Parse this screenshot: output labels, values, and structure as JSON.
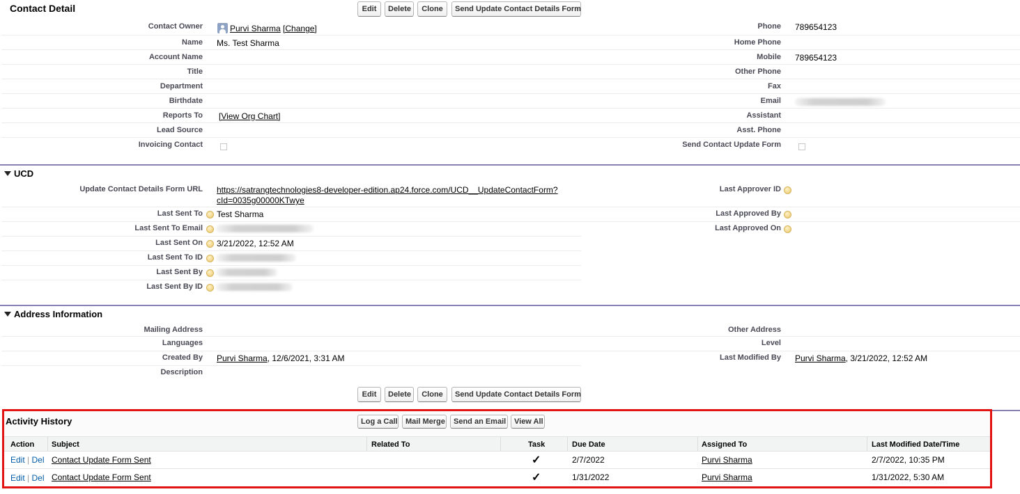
{
  "detail": {
    "title": "Contact Detail",
    "buttons": [
      "Edit",
      "Delete",
      "Clone",
      "Send Update Contact Details Form"
    ]
  },
  "contact": {
    "left": [
      {
        "label": "Contact Owner",
        "value": "Purvi Sharma",
        "extra": "[Change]"
      },
      {
        "label": "Name",
        "value": "Ms. Test Sharma"
      },
      {
        "label": "Account Name",
        "value": ""
      },
      {
        "label": "Title",
        "value": ""
      },
      {
        "label": "Department",
        "value": ""
      },
      {
        "label": "Birthdate",
        "value": ""
      },
      {
        "label": "Reports To",
        "value": "[View Org Chart]"
      },
      {
        "label": "Lead Source",
        "value": ""
      },
      {
        "label": "Invoicing Contact",
        "value": ""
      }
    ],
    "right": [
      {
        "label": "Phone",
        "value": "789654123"
      },
      {
        "label": "Home Phone",
        "value": ""
      },
      {
        "label": "Mobile",
        "value": "789654123"
      },
      {
        "label": "Other Phone",
        "value": ""
      },
      {
        "label": "Fax",
        "value": ""
      },
      {
        "label": "Email",
        "value": ""
      },
      {
        "label": "Assistant",
        "value": ""
      },
      {
        "label": "Asst. Phone",
        "value": ""
      },
      {
        "label": "Send Contact Update Form",
        "value": ""
      }
    ]
  },
  "ucd": {
    "title": "UCD",
    "left": [
      {
        "label": "Update Contact Details Form URL",
        "value_line1": "https://satrangtechnologies8-developer-edition.ap24.force.com/UCD__UpdateContactForm?",
        "value_line2": "cId=0035g00000KTwye"
      },
      {
        "label": "Last Sent To",
        "value": "Test Sharma"
      },
      {
        "label": "Last Sent To Email",
        "value": ""
      },
      {
        "label": "Last Sent On",
        "value": "3/21/2022, 12:52 AM"
      },
      {
        "label": "Last Sent To ID",
        "value": ""
      },
      {
        "label": "Last Sent By",
        "value": ""
      },
      {
        "label": "Last Sent By ID",
        "value": ""
      }
    ],
    "right": [
      {
        "label": "Last Approver ID",
        "value": ""
      },
      {
        "label": "Last Approved By",
        "value": ""
      },
      {
        "label": "Last Approved On",
        "value": ""
      }
    ]
  },
  "address": {
    "title": "Address Information",
    "left": [
      {
        "label": "Mailing Address",
        "value": ""
      },
      {
        "label": "Languages",
        "value": ""
      },
      {
        "label": "Created By",
        "value": "Purvi Sharma",
        "extra": ", 12/6/2021, 3:31 AM"
      },
      {
        "label": "Description",
        "value": ""
      }
    ],
    "right": [
      {
        "label": "Other Address",
        "value": ""
      },
      {
        "label": "Level",
        "value": ""
      },
      {
        "label": "Last Modified By",
        "value": "Purvi Sharma",
        "extra": ", 3/21/2022, 12:52 AM"
      }
    ]
  },
  "activity": {
    "title": "Activity History",
    "buttons": [
      "Log a Call",
      "Mail Merge",
      "Send an Email",
      "View All"
    ],
    "columns": [
      "Action",
      "Subject",
      "Related To",
      "Task",
      "Due Date",
      "Assigned To",
      "Last Modified Date/Time"
    ],
    "action_edit": "Edit",
    "action_sep": "|",
    "action_del": "Del",
    "task_check": "✓",
    "rows": [
      {
        "subject": "Contact Update Form Sent",
        "related": "",
        "due": "2/7/2022",
        "assigned": "Purvi Sharma",
        "modified": "2/7/2022, 10:35 PM"
      },
      {
        "subject": "Contact Update Form Sent",
        "related": "",
        "due": "1/31/2022",
        "assigned": "Purvi Sharma",
        "modified": "1/31/2022, 5:30 AM"
      }
    ]
  },
  "colors": {
    "section_line": "#8a7fb5",
    "highlight_border": "#e21313",
    "action_link": "#015ba7"
  },
  "icons": {
    "owner": "user-avatar-icon",
    "help": "help-bubble-icon",
    "collapse": "triangle-down-icon",
    "check": "checkmark-icon"
  }
}
